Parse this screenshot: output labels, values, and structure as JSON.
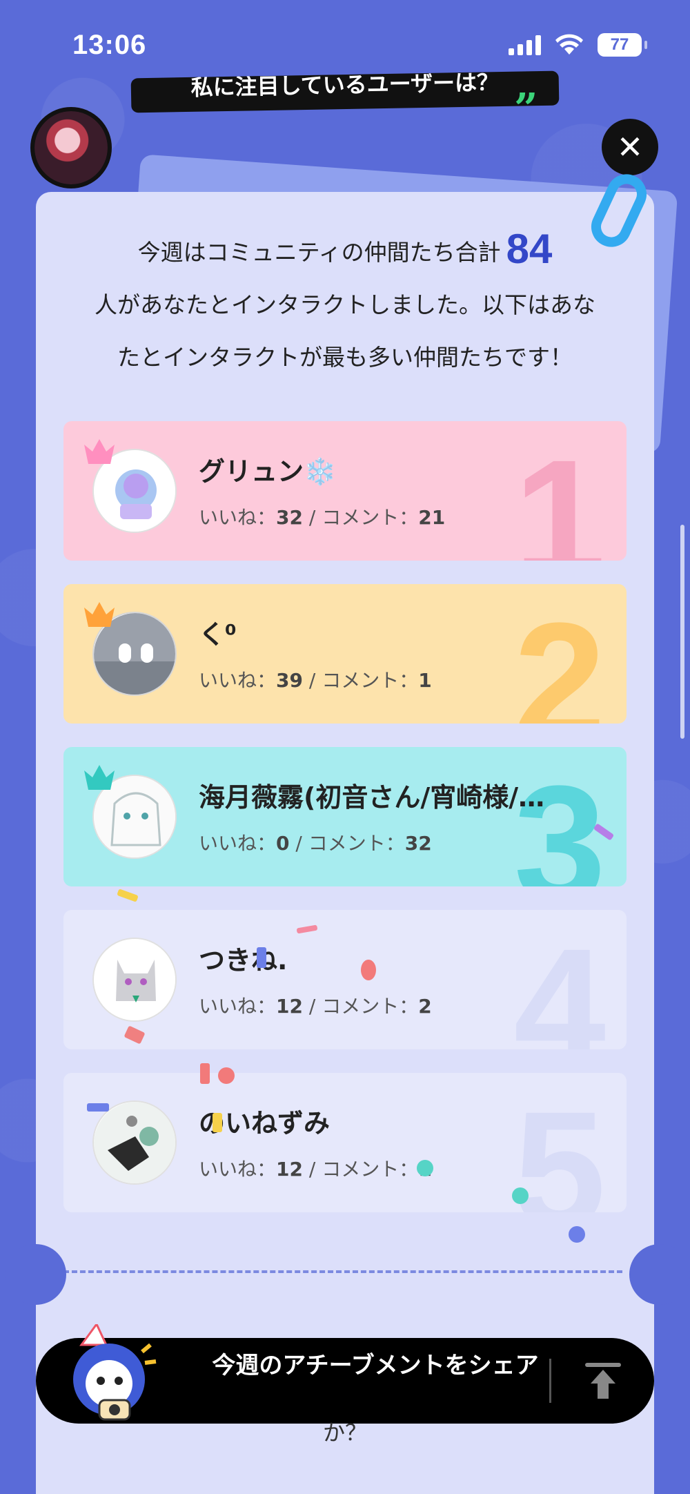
{
  "status_bar": {
    "time": "13:06",
    "battery": "77"
  },
  "header": {
    "banner_text": "私に注目しているユーザーは？"
  },
  "intro": {
    "line1_before": "今週はコミュニティの仲間たち合計",
    "count": "84",
    "line2": "人があなたとインタラクトしました。以下はあな",
    "line3": "たとインタラクトが最も多い仲間たちです！"
  },
  "ranking": [
    {
      "rank": "1",
      "name": "グリュン❄️",
      "likes_label": "いいね：",
      "likes": "32",
      "sep": " / コメント：",
      "comments": "21"
    },
    {
      "rank": "2",
      "name": "く⁰",
      "likes_label": "いいね：",
      "likes": "39",
      "sep": " / コメント：",
      "comments": "1"
    },
    {
      "rank": "3",
      "name": "海月薇霧(初音さん/宵崎様/…",
      "likes_label": "いいね：",
      "likes": "0",
      "sep": " / コメント：",
      "comments": "32"
    },
    {
      "rank": "4",
      "name": "つきね.",
      "likes_label": "いいね：",
      "likes": "12",
      "sep": " / コメント：",
      "comments": "2"
    },
    {
      "rank": "5",
      "name": "のいねずみ",
      "likes_label": "いいね：",
      "likes": "12",
      "sep": " / コメント：",
      "comments": "1"
    }
  ],
  "share": {
    "label": "今週のアチーブメントをシェア",
    "below_text": "か？"
  },
  "colors": {
    "background": "#5a6bd8",
    "card": "#dcdffa",
    "accent_number": "#3347c8"
  }
}
